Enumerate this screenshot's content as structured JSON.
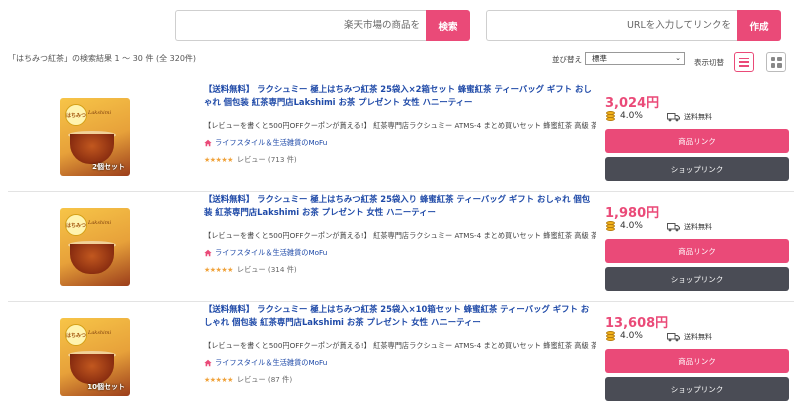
{
  "search": {
    "rakuten_placeholder": "楽天市場の商品を",
    "rakuten_button": "検索",
    "url_placeholder": "URLを入力してリンクを",
    "url_button": "作成"
  },
  "results": {
    "summary": "「はちみつ紅茶」の検索結果 1 ～ 30 件 (全 320件)",
    "sort_label": "並び替え",
    "sort_selected": "標準",
    "view_label": "表示切替"
  },
  "colors": {
    "accent": "#ea4a78",
    "dark_button": "#4a4c55",
    "link": "#1f4aa8",
    "star": "#f0a23a"
  },
  "icons": [
    "list-view-icon",
    "grid-view-icon",
    "home-icon",
    "star-icon",
    "coin-icon",
    "truck-icon"
  ],
  "products": [
    {
      "title": "【送料無料】 ラクシュミー 極上はちみつ紅茶 25袋入×2箱セット 蜂蜜紅茶 ティーバッグ ギフト おしゃれ 個包装 紅茶専門店Lakshimi お茶 プレゼント 女性 ハニーティー",
      "description": "【レビューを書くと500円OFFクーポンが貰える!】 紅茶専門店ラクシュミー ATMS-4 まとめ買いセット 蜂蜜紅茶 高級 茶...",
      "shop": "ライフスタイル＆生活雑貨のMoFu",
      "stars": "★★★★★",
      "reviews": "レビュー (713 件)",
      "price": "3,024円",
      "points": "4.0%",
      "shipping": "送料無料",
      "item_link": "商品リンク",
      "shop_link": "ショップリンク",
      "set_label": "2個セット",
      "thumb_brand": "Lakshimi",
      "thumb_tag": "はちみつ"
    },
    {
      "title": "【送料無料】 ラクシュミー 極上はちみつ紅茶 25袋入り 蜂蜜紅茶 ティーバッグ ギフト おしゃれ 個包装 紅茶専門店Lakshimi お茶 プレゼント 女性 ハニーティー",
      "description": "【レビューを書くと500円OFFクーポンが貰える!】 紅茶専門店ラクシュミー ATMS-4 まとめ買いセット 蜂蜜紅茶 高級 茶...",
      "shop": "ライフスタイル＆生活雑貨のMoFu",
      "stars": "★★★★★",
      "reviews": "レビュー (314 件)",
      "price": "1,980円",
      "points": "4.0%",
      "shipping": "送料無料",
      "item_link": "商品リンク",
      "shop_link": "ショップリンク",
      "set_label": "",
      "thumb_brand": "Lakshimi",
      "thumb_tag": "はちみつ"
    },
    {
      "title": "【送料無料】 ラクシュミー 極上はちみつ紅茶 25袋入×10箱セット 蜂蜜紅茶 ティーバッグ ギフト おしゃれ 個包装 紅茶専門店Lakshimi お茶 プレゼント 女性 ハニーティー",
      "description": "【レビューを書くと500円OFFクーポンが貰える!】 紅茶専門店ラクシュミー ATMS-4 まとめ買いセット 蜂蜜紅茶 高級 茶...",
      "shop": "ライフスタイル＆生活雑貨のMoFu",
      "stars": "★★★★★",
      "reviews": "レビュー (87 件)",
      "price": "13,608円",
      "points": "4.0%",
      "shipping": "送料無料",
      "item_link": "商品リンク",
      "shop_link": "ショップリンク",
      "set_label": "10個セット",
      "thumb_brand": "Lakshimi",
      "thumb_tag": "はちみつ"
    }
  ]
}
